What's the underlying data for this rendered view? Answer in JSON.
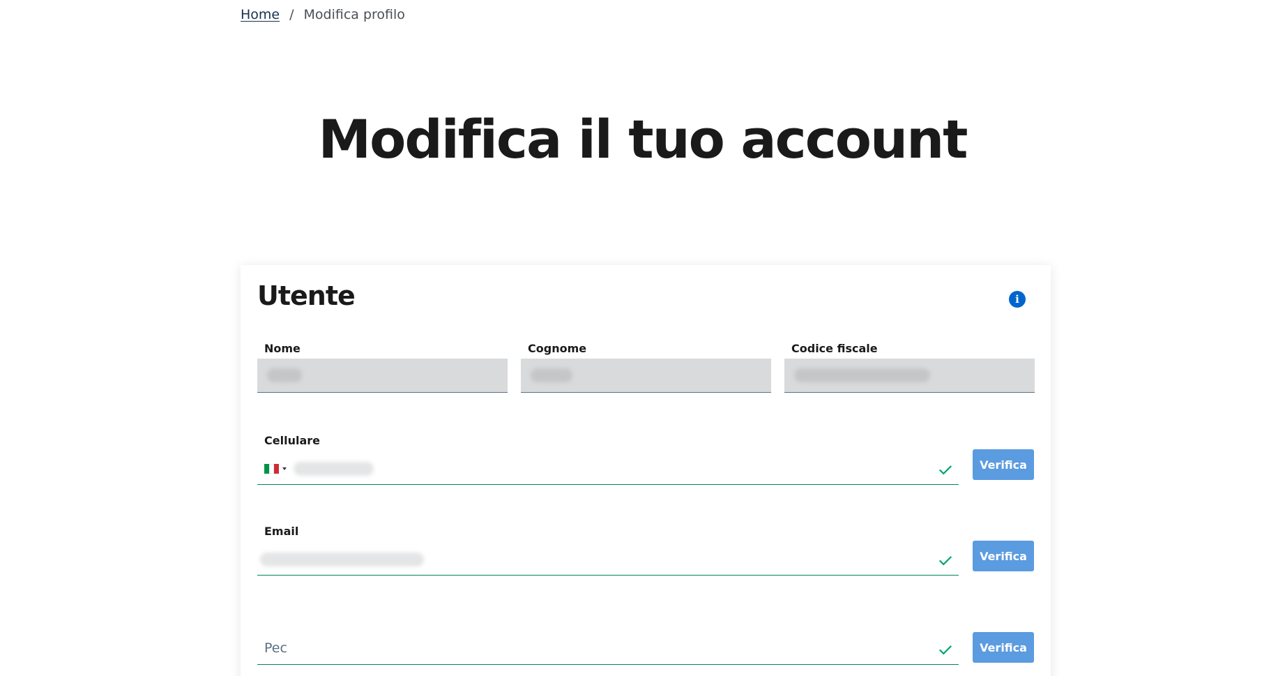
{
  "breadcrumb": {
    "home": "Home",
    "separator": "/",
    "current": "Modifica profilo"
  },
  "title": "Modifica il tuo account",
  "card": {
    "title": "Utente",
    "info_icon": "info-icon"
  },
  "fields": {
    "nome": {
      "label": "Nome"
    },
    "cognome": {
      "label": "Cognome"
    },
    "codice_fiscale": {
      "label": "Codice fiscale"
    },
    "cellulare": {
      "label": "Cellulare",
      "country": "IT"
    },
    "email": {
      "label": "Email"
    },
    "pec": {
      "placeholder": "Pec"
    }
  },
  "buttons": {
    "verifica": "Verifica"
  },
  "colors": {
    "primary": "#0066cc",
    "button": "#5b9be0",
    "valid": "#00a86b",
    "readonly_bg": "#d9dadb"
  }
}
